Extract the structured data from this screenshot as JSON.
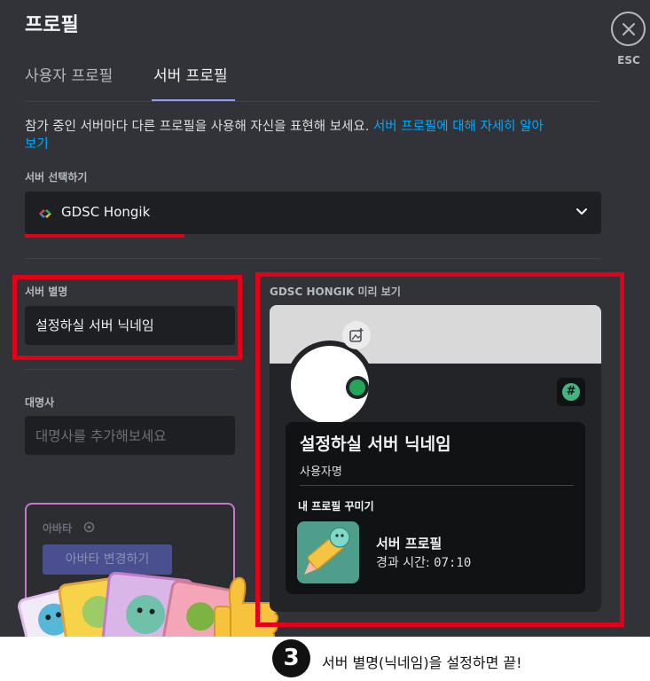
{
  "header": {
    "title": "프로필",
    "esc_label": "ESC"
  },
  "tabs": [
    {
      "label": "사용자 프로필",
      "active": false
    },
    {
      "label": "서버 프로필",
      "active": true
    }
  ],
  "description": {
    "text": "참가 중인 서버마다 다른 프로필을 사용해 자신을 표현해 보세요. ",
    "link": "서버 프로필에 대해 자세히 알아",
    "link_cont": "보기"
  },
  "server_select": {
    "label": "서버 선택하기",
    "value": "GDSC Hongik"
  },
  "nickname": {
    "label": "서버 별명",
    "value": "설정하실 서버 닉네임"
  },
  "pronouns": {
    "label": "대명사",
    "placeholder": "대명사를 추가해보세요"
  },
  "avatar": {
    "title": "아바타",
    "button": "아바타 변경하기"
  },
  "preview": {
    "label": "GDSC HONGIK 미리 보기",
    "display_name": "설정하실 서버 닉네임",
    "username": "사용자명",
    "section_title": "내 프로필 꾸미기",
    "activity_title": "서버 프로필",
    "activity_time_label": "경과 시간: ",
    "activity_time": "07:10"
  },
  "instruction": {
    "step": "3",
    "text": "서버 별명(닉네임)을 설정하면 끝!"
  },
  "colors": {
    "accent": "#949cf7",
    "link": "#00a8fc",
    "highlight": "#e5001a",
    "online": "#23a55a"
  }
}
